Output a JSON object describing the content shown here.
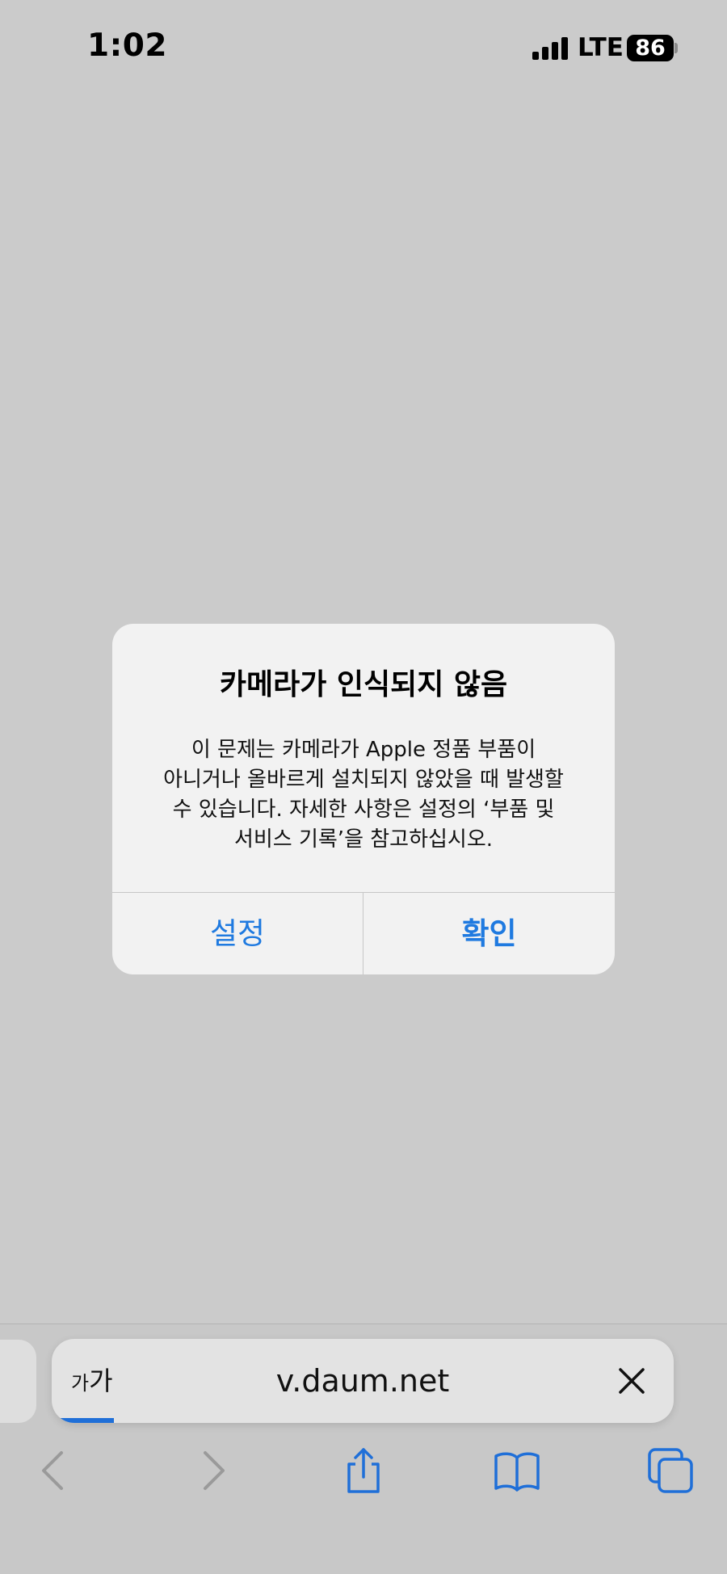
{
  "status_bar": {
    "time": "1:02",
    "network": "LTE",
    "battery": "86"
  },
  "alert": {
    "title": "카메라가 인식되지 않음",
    "message_lines": [
      "이 문제는 카메라가 Apple 정품 부품이",
      "아니거나 올바르게 설치되지 않았을 때 발생할",
      "수 있습니다. 자세한 사항은 설정의 ‘부품 및",
      "서비스 기록’을 참고하십시오."
    ],
    "buttons": {
      "settings": "설정",
      "confirm": "확인"
    }
  },
  "browser": {
    "text_size_large": "가",
    "text_size_small": "가",
    "url": "v.daum.net",
    "load_progress": 0.1,
    "icons": [
      "back-icon",
      "forward-icon",
      "share-icon",
      "bookmarks-icon",
      "tabs-icon"
    ]
  },
  "colors": {
    "background": "#cbcbcb",
    "alert_bg": "#f2f2f2",
    "accent": "#1f7ae0"
  }
}
